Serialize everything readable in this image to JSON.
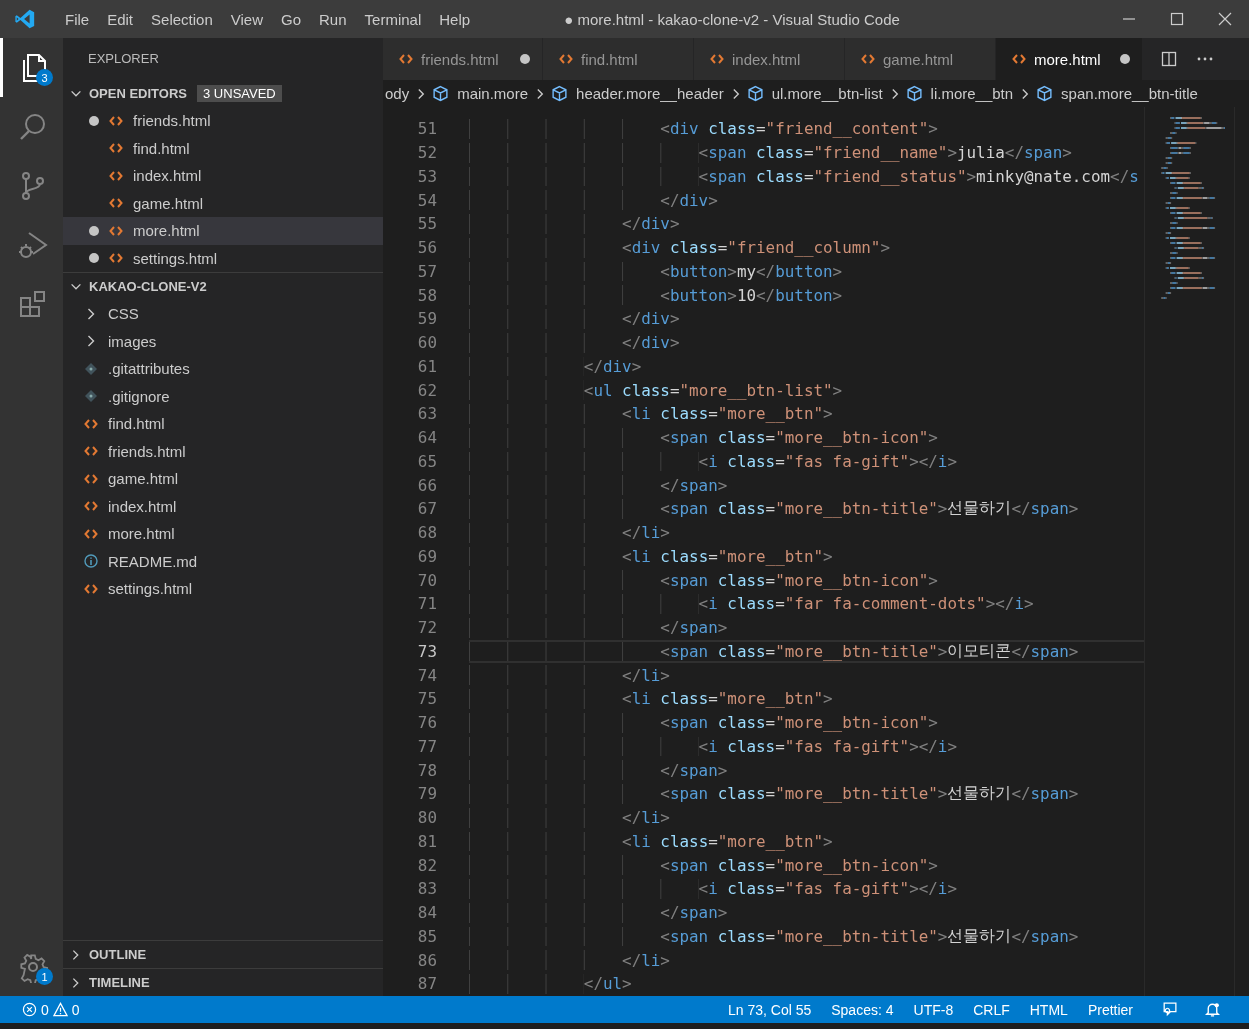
{
  "window": {
    "title": "● more.html - kakao-clone-v2 - Visual Studio Code"
  },
  "menu": [
    "File",
    "Edit",
    "Selection",
    "View",
    "Go",
    "Run",
    "Terminal",
    "Help"
  ],
  "activity_bar": [
    {
      "kind": "files",
      "selected": true,
      "badge": "3"
    },
    {
      "kind": "search",
      "selected": false
    },
    {
      "kind": "source-control",
      "selected": false
    },
    {
      "kind": "run",
      "selected": false
    },
    {
      "kind": "extensions",
      "selected": false
    }
  ],
  "manage": {
    "badge": "1"
  },
  "sidebar": {
    "title": "EXPLORER",
    "open_editors": {
      "title": "OPEN EDITORS",
      "badge": "3 UNSAVED",
      "expanded": true,
      "items": [
        {
          "name": "friends.html",
          "dirty": true,
          "selected": false
        },
        {
          "name": "find.html",
          "dirty": false,
          "selected": false
        },
        {
          "name": "index.html",
          "dirty": false,
          "selected": false
        },
        {
          "name": "game.html",
          "dirty": false,
          "selected": false
        },
        {
          "name": "more.html",
          "dirty": true,
          "selected": true
        },
        {
          "name": "settings.html",
          "dirty": true,
          "selected": false
        }
      ]
    },
    "folder": {
      "title": "KAKAO-CLONE-V2",
      "expanded": true,
      "items": [
        {
          "name": "CSS",
          "kind": "folder"
        },
        {
          "name": "images",
          "kind": "folder"
        },
        {
          "name": ".gitattributes",
          "kind": "git"
        },
        {
          "name": ".gitignore",
          "kind": "git"
        },
        {
          "name": "find.html",
          "kind": "html"
        },
        {
          "name": "friends.html",
          "kind": "html"
        },
        {
          "name": "game.html",
          "kind": "html"
        },
        {
          "name": "index.html",
          "kind": "html"
        },
        {
          "name": "more.html",
          "kind": "html"
        },
        {
          "name": "README.md",
          "kind": "info"
        },
        {
          "name": "settings.html",
          "kind": "html"
        }
      ]
    },
    "panels": [
      {
        "title": "OUTLINE",
        "expanded": false
      },
      {
        "title": "TIMELINE",
        "expanded": false
      }
    ]
  },
  "tabs": [
    {
      "label": "friends.html",
      "dirty": true,
      "selected": false
    },
    {
      "label": "find.html",
      "dirty": false,
      "selected": false
    },
    {
      "label": "index.html",
      "dirty": false,
      "selected": false
    },
    {
      "label": "game.html",
      "dirty": false,
      "selected": false
    },
    {
      "label": "more.html",
      "dirty": true,
      "selected": true
    }
  ],
  "breadcrumb": [
    "ody",
    "main.more",
    "header.more__header",
    "ul.more__btn-list",
    "li.more__btn",
    "span.more__btn-title"
  ],
  "code": [
    {
      "number": "51",
      "current": false,
      "tokens": [
        {
          "kind": "punct",
          "text": "                    <"
        },
        {
          "kind": "tag",
          "text": "div"
        },
        {
          "kind": "attr",
          "text": " class"
        },
        {
          "kind": "op",
          "text": "="
        },
        {
          "kind": "string",
          "text": "\"friend__content\""
        },
        {
          "kind": "punct",
          "text": ">"
        }
      ]
    },
    {
      "number": "52",
      "current": false,
      "tokens": [
        {
          "kind": "punct",
          "text": "                        <"
        },
        {
          "kind": "tag",
          "text": "span"
        },
        {
          "kind": "attr",
          "text": " class"
        },
        {
          "kind": "op",
          "text": "="
        },
        {
          "kind": "string",
          "text": "\"friend__name\""
        },
        {
          "kind": "punct",
          "text": ">"
        },
        {
          "kind": "text",
          "text": "julia"
        },
        {
          "kind": "punct",
          "text": "</"
        },
        {
          "kind": "tag",
          "text": "span"
        },
        {
          "kind": "punct",
          "text": ">"
        }
      ]
    },
    {
      "number": "53",
      "current": false,
      "tokens": [
        {
          "kind": "punct",
          "text": "                        <"
        },
        {
          "kind": "tag",
          "text": "span"
        },
        {
          "kind": "attr",
          "text": " class"
        },
        {
          "kind": "op",
          "text": "="
        },
        {
          "kind": "string",
          "text": "\"friend__status\""
        },
        {
          "kind": "punct",
          "text": ">"
        },
        {
          "kind": "text",
          "text": "minky@nate.com"
        },
        {
          "kind": "punct",
          "text": "</"
        },
        {
          "kind": "tag",
          "text": "s"
        }
      ]
    },
    {
      "number": "54",
      "current": false,
      "tokens": [
        {
          "kind": "punct",
          "text": "                    </"
        },
        {
          "kind": "tag",
          "text": "div"
        },
        {
          "kind": "punct",
          "text": ">"
        }
      ]
    },
    {
      "number": "55",
      "current": false,
      "tokens": [
        {
          "kind": "punct",
          "text": "                </"
        },
        {
          "kind": "tag",
          "text": "div"
        },
        {
          "kind": "punct",
          "text": ">"
        }
      ]
    },
    {
      "number": "56",
      "current": false,
      "tokens": [
        {
          "kind": "punct",
          "text": "                <"
        },
        {
          "kind": "tag",
          "text": "div"
        },
        {
          "kind": "attr",
          "text": " class"
        },
        {
          "kind": "op",
          "text": "="
        },
        {
          "kind": "string",
          "text": "\"friend__column\""
        },
        {
          "kind": "punct",
          "text": ">"
        }
      ]
    },
    {
      "number": "57",
      "current": false,
      "tokens": [
        {
          "kind": "punct",
          "text": "                    <"
        },
        {
          "kind": "tag",
          "text": "button"
        },
        {
          "kind": "punct",
          "text": ">"
        },
        {
          "kind": "text",
          "text": "my"
        },
        {
          "kind": "punct",
          "text": "</"
        },
        {
          "kind": "tag",
          "text": "button"
        },
        {
          "kind": "punct",
          "text": ">"
        }
      ]
    },
    {
      "number": "58",
      "current": false,
      "tokens": [
        {
          "kind": "punct",
          "text": "                    <"
        },
        {
          "kind": "tag",
          "text": "button"
        },
        {
          "kind": "punct",
          "text": ">"
        },
        {
          "kind": "text",
          "text": "10"
        },
        {
          "kind": "punct",
          "text": "</"
        },
        {
          "kind": "tag",
          "text": "button"
        },
        {
          "kind": "punct",
          "text": ">"
        }
      ]
    },
    {
      "number": "59",
      "current": false,
      "tokens": [
        {
          "kind": "punct",
          "text": "                </"
        },
        {
          "kind": "tag",
          "text": "div"
        },
        {
          "kind": "punct",
          "text": ">"
        }
      ]
    },
    {
      "number": "60",
      "current": false,
      "tokens": [
        {
          "kind": "punct",
          "text": "                </"
        },
        {
          "kind": "tag",
          "text": "div"
        },
        {
          "kind": "punct",
          "text": ">"
        }
      ]
    },
    {
      "number": "61",
      "current": false,
      "tokens": [
        {
          "kind": "punct",
          "text": "            </"
        },
        {
          "kind": "tag",
          "text": "div"
        },
        {
          "kind": "punct",
          "text": ">"
        }
      ]
    },
    {
      "number": "62",
      "current": false,
      "tokens": [
        {
          "kind": "punct",
          "text": "            <"
        },
        {
          "kind": "tag",
          "text": "ul"
        },
        {
          "kind": "attr",
          "text": " class"
        },
        {
          "kind": "op",
          "text": "="
        },
        {
          "kind": "string",
          "text": "\"more__btn-list\""
        },
        {
          "kind": "punct",
          "text": ">"
        }
      ]
    },
    {
      "number": "63",
      "current": false,
      "tokens": [
        {
          "kind": "punct",
          "text": "                <"
        },
        {
          "kind": "tag",
          "text": "li"
        },
        {
          "kind": "attr",
          "text": " class"
        },
        {
          "kind": "op",
          "text": "="
        },
        {
          "kind": "string",
          "text": "\"more__btn\""
        },
        {
          "kind": "punct",
          "text": ">"
        }
      ]
    },
    {
      "number": "64",
      "current": false,
      "tokens": [
        {
          "kind": "punct",
          "text": "                    <"
        },
        {
          "kind": "tag",
          "text": "span"
        },
        {
          "kind": "attr",
          "text": " class"
        },
        {
          "kind": "op",
          "text": "="
        },
        {
          "kind": "string",
          "text": "\"more__btn-icon\""
        },
        {
          "kind": "punct",
          "text": ">"
        }
      ]
    },
    {
      "number": "65",
      "current": false,
      "tokens": [
        {
          "kind": "punct",
          "text": "                        <"
        },
        {
          "kind": "tag",
          "text": "i"
        },
        {
          "kind": "attr",
          "text": " class"
        },
        {
          "kind": "op",
          "text": "="
        },
        {
          "kind": "string",
          "text": "\"fas fa-gift\""
        },
        {
          "kind": "punct",
          "text": "></"
        },
        {
          "kind": "tag",
          "text": "i"
        },
        {
          "kind": "punct",
          "text": ">"
        }
      ]
    },
    {
      "number": "66",
      "current": false,
      "tokens": [
        {
          "kind": "punct",
          "text": "                    </"
        },
        {
          "kind": "tag",
          "text": "span"
        },
        {
          "kind": "punct",
          "text": ">"
        }
      ]
    },
    {
      "number": "67",
      "current": false,
      "tokens": [
        {
          "kind": "punct",
          "text": "                    <"
        },
        {
          "kind": "tag",
          "text": "span"
        },
        {
          "kind": "attr",
          "text": " class"
        },
        {
          "kind": "op",
          "text": "="
        },
        {
          "kind": "string",
          "text": "\"more__btn-title\""
        },
        {
          "kind": "punct",
          "text": ">"
        },
        {
          "kind": "text",
          "text": "선물하기"
        },
        {
          "kind": "punct",
          "text": "</"
        },
        {
          "kind": "tag",
          "text": "span"
        },
        {
          "kind": "punct",
          "text": ">"
        }
      ]
    },
    {
      "number": "68",
      "current": false,
      "tokens": [
        {
          "kind": "punct",
          "text": "                </"
        },
        {
          "kind": "tag",
          "text": "li"
        },
        {
          "kind": "punct",
          "text": ">"
        }
      ]
    },
    {
      "number": "69",
      "current": false,
      "tokens": [
        {
          "kind": "punct",
          "text": "                <"
        },
        {
          "kind": "tag",
          "text": "li"
        },
        {
          "kind": "attr",
          "text": " class"
        },
        {
          "kind": "op",
          "text": "="
        },
        {
          "kind": "string",
          "text": "\"more__btn\""
        },
        {
          "kind": "punct",
          "text": ">"
        }
      ]
    },
    {
      "number": "70",
      "current": false,
      "tokens": [
        {
          "kind": "punct",
          "text": "                    <"
        },
        {
          "kind": "tag",
          "text": "span"
        },
        {
          "kind": "attr",
          "text": " class"
        },
        {
          "kind": "op",
          "text": "="
        },
        {
          "kind": "string",
          "text": "\"more__btn-icon\""
        },
        {
          "kind": "punct",
          "text": ">"
        }
      ]
    },
    {
      "number": "71",
      "current": false,
      "tokens": [
        {
          "kind": "punct",
          "text": "                        <"
        },
        {
          "kind": "tag",
          "text": "i"
        },
        {
          "kind": "attr",
          "text": " class"
        },
        {
          "kind": "op",
          "text": "="
        },
        {
          "kind": "string",
          "text": "\"far fa-comment-dots\""
        },
        {
          "kind": "punct",
          "text": "></"
        },
        {
          "kind": "tag",
          "text": "i"
        },
        {
          "kind": "punct",
          "text": ">"
        }
      ]
    },
    {
      "number": "72",
      "current": false,
      "tokens": [
        {
          "kind": "punct",
          "text": "                    </"
        },
        {
          "kind": "tag",
          "text": "span"
        },
        {
          "kind": "punct",
          "text": ">"
        }
      ]
    },
    {
      "number": "73",
      "current": true,
      "tokens": [
        {
          "kind": "punct",
          "text": "                    <"
        },
        {
          "kind": "tag",
          "text": "span"
        },
        {
          "kind": "attr",
          "text": " class"
        },
        {
          "kind": "op",
          "text": "="
        },
        {
          "kind": "string",
          "text": "\"more__btn-title\""
        },
        {
          "kind": "punct",
          "text": ">"
        },
        {
          "kind": "text",
          "text": "이모티콘"
        },
        {
          "kind": "punct",
          "text": "</"
        },
        {
          "kind": "tag",
          "text": "span"
        },
        {
          "kind": "punct",
          "text": ">"
        }
      ]
    },
    {
      "number": "74",
      "current": false,
      "tokens": [
        {
          "kind": "punct",
          "text": "                </"
        },
        {
          "kind": "tag",
          "text": "li"
        },
        {
          "kind": "punct",
          "text": ">"
        }
      ]
    },
    {
      "number": "75",
      "current": false,
      "tokens": [
        {
          "kind": "punct",
          "text": "                <"
        },
        {
          "kind": "tag",
          "text": "li"
        },
        {
          "kind": "attr",
          "text": " class"
        },
        {
          "kind": "op",
          "text": "="
        },
        {
          "kind": "string",
          "text": "\"more__btn\""
        },
        {
          "kind": "punct",
          "text": ">"
        }
      ]
    },
    {
      "number": "76",
      "current": false,
      "tokens": [
        {
          "kind": "punct",
          "text": "                    <"
        },
        {
          "kind": "tag",
          "text": "span"
        },
        {
          "kind": "attr",
          "text": " class"
        },
        {
          "kind": "op",
          "text": "="
        },
        {
          "kind": "string",
          "text": "\"more__btn-icon\""
        },
        {
          "kind": "punct",
          "text": ">"
        }
      ]
    },
    {
      "number": "77",
      "current": false,
      "tokens": [
        {
          "kind": "punct",
          "text": "                        <"
        },
        {
          "kind": "tag",
          "text": "i"
        },
        {
          "kind": "attr",
          "text": " class"
        },
        {
          "kind": "op",
          "text": "="
        },
        {
          "kind": "string",
          "text": "\"fas fa-gift\""
        },
        {
          "kind": "punct",
          "text": "></"
        },
        {
          "kind": "tag",
          "text": "i"
        },
        {
          "kind": "punct",
          "text": ">"
        }
      ]
    },
    {
      "number": "78",
      "current": false,
      "tokens": [
        {
          "kind": "punct",
          "text": "                    </"
        },
        {
          "kind": "tag",
          "text": "span"
        },
        {
          "kind": "punct",
          "text": ">"
        }
      ]
    },
    {
      "number": "79",
      "current": false,
      "tokens": [
        {
          "kind": "punct",
          "text": "                    <"
        },
        {
          "kind": "tag",
          "text": "span"
        },
        {
          "kind": "attr",
          "text": " class"
        },
        {
          "kind": "op",
          "text": "="
        },
        {
          "kind": "string",
          "text": "\"more__btn-title\""
        },
        {
          "kind": "punct",
          "text": ">"
        },
        {
          "kind": "text",
          "text": "선물하기"
        },
        {
          "kind": "punct",
          "text": "</"
        },
        {
          "kind": "tag",
          "text": "span"
        },
        {
          "kind": "punct",
          "text": ">"
        }
      ]
    },
    {
      "number": "80",
      "current": false,
      "tokens": [
        {
          "kind": "punct",
          "text": "                </"
        },
        {
          "kind": "tag",
          "text": "li"
        },
        {
          "kind": "punct",
          "text": ">"
        }
      ]
    },
    {
      "number": "81",
      "current": false,
      "tokens": [
        {
          "kind": "punct",
          "text": "                <"
        },
        {
          "kind": "tag",
          "text": "li"
        },
        {
          "kind": "attr",
          "text": " class"
        },
        {
          "kind": "op",
          "text": "="
        },
        {
          "kind": "string",
          "text": "\"more__btn\""
        },
        {
          "kind": "punct",
          "text": ">"
        }
      ]
    },
    {
      "number": "82",
      "current": false,
      "tokens": [
        {
          "kind": "punct",
          "text": "                    <"
        },
        {
          "kind": "tag",
          "text": "span"
        },
        {
          "kind": "attr",
          "text": " class"
        },
        {
          "kind": "op",
          "text": "="
        },
        {
          "kind": "string",
          "text": "\"more__btn-icon\""
        },
        {
          "kind": "punct",
          "text": ">"
        }
      ]
    },
    {
      "number": "83",
      "current": false,
      "tokens": [
        {
          "kind": "punct",
          "text": "                        <"
        },
        {
          "kind": "tag",
          "text": "i"
        },
        {
          "kind": "attr",
          "text": " class"
        },
        {
          "kind": "op",
          "text": "="
        },
        {
          "kind": "string",
          "text": "\"fas fa-gift\""
        },
        {
          "kind": "punct",
          "text": "></"
        },
        {
          "kind": "tag",
          "text": "i"
        },
        {
          "kind": "punct",
          "text": ">"
        }
      ]
    },
    {
      "number": "84",
      "current": false,
      "tokens": [
        {
          "kind": "punct",
          "text": "                    </"
        },
        {
          "kind": "tag",
          "text": "span"
        },
        {
          "kind": "punct",
          "text": ">"
        }
      ]
    },
    {
      "number": "85",
      "current": false,
      "tokens": [
        {
          "kind": "punct",
          "text": "                    <"
        },
        {
          "kind": "tag",
          "text": "span"
        },
        {
          "kind": "attr",
          "text": " class"
        },
        {
          "kind": "op",
          "text": "="
        },
        {
          "kind": "string",
          "text": "\"more__btn-title\""
        },
        {
          "kind": "punct",
          "text": ">"
        },
        {
          "kind": "text",
          "text": "선물하기"
        },
        {
          "kind": "punct",
          "text": "</"
        },
        {
          "kind": "tag",
          "text": "span"
        },
        {
          "kind": "punct",
          "text": ">"
        }
      ]
    },
    {
      "number": "86",
      "current": false,
      "tokens": [
        {
          "kind": "punct",
          "text": "                </"
        },
        {
          "kind": "tag",
          "text": "li"
        },
        {
          "kind": "punct",
          "text": ">"
        }
      ]
    },
    {
      "number": "87",
      "current": false,
      "tokens": [
        {
          "kind": "punct",
          "text": "            </"
        },
        {
          "kind": "tag",
          "text": "ul"
        },
        {
          "kind": "punct",
          "text": ">"
        }
      ]
    }
  ],
  "status_bar": {
    "errors": "0",
    "warnings": "0",
    "items": [
      "Ln 73, Col 55",
      "Spaces: 4",
      "UTF-8",
      "CRLF",
      "HTML",
      "Prettier"
    ]
  }
}
